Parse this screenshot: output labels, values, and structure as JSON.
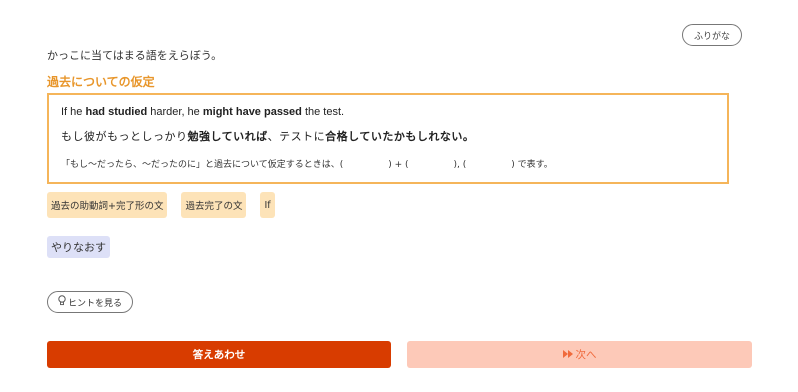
{
  "furigana_button": "ふりがな",
  "instruction": "かっこに当てはまる語をえらぼう。",
  "section_title": "過去についての仮定",
  "example": {
    "en": [
      {
        "text": "If he ",
        "bold": false
      },
      {
        "text": "had studied",
        "bold": true
      },
      {
        "text": " harder, he ",
        "bold": false
      },
      {
        "text": "might have passed",
        "bold": true
      },
      {
        "text": " the test.",
        "bold": false
      }
    ],
    "jp": [
      {
        "text": "もし彼がもっとしっかり",
        "bold": false
      },
      {
        "text": "勉強していれば",
        "bold": true
      },
      {
        "text": "、テストに",
        "bold": false
      },
      {
        "text": "合格していたかもしれない。",
        "bold": true
      }
    ],
    "note": "「もし～だったら、～だったのに」と過去について仮定するときは、(　　　　　) + (　　　　　), (　　　　　) で表す。"
  },
  "choices": [
    "過去の助動詞+完了形の文",
    "過去完了の文",
    "If"
  ],
  "redo_button": "やりなおす",
  "hint_button": "ヒントを見る",
  "answer_button": "答えあわせ",
  "next_button": "次へ",
  "colors": {
    "accent": "#e8962b",
    "box_border": "#f5b55a",
    "chip_bg": "#fde3b8",
    "redo_bg": "#dde0f7",
    "answer_bg": "#d83c00",
    "next_bg": "#fdc9b8",
    "next_text": "#f06a3c"
  },
  "icons": {
    "hint": "lightbulb-icon",
    "next": "fast-forward-icon"
  }
}
